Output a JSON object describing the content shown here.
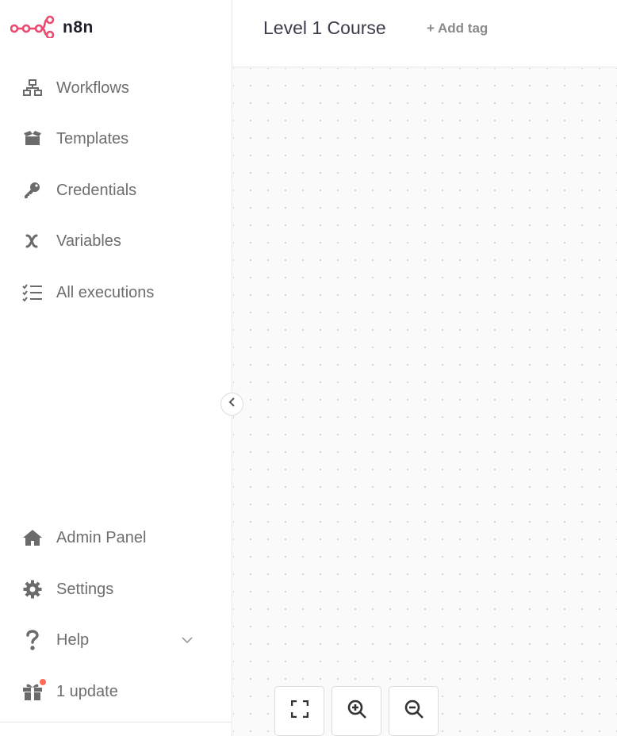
{
  "brand": {
    "name": "n8n",
    "logo_color": "#ea4b71"
  },
  "sidebar": {
    "items": [
      {
        "label": "Workflows",
        "icon": "workflows-icon"
      },
      {
        "label": "Templates",
        "icon": "templates-icon"
      },
      {
        "label": "Credentials",
        "icon": "key-icon"
      },
      {
        "label": "Variables",
        "icon": "variables-icon"
      },
      {
        "label": "All executions",
        "icon": "executions-icon"
      }
    ],
    "bottom_items": [
      {
        "label": "Admin Panel",
        "icon": "home-icon"
      },
      {
        "label": "Settings",
        "icon": "gear-icon"
      },
      {
        "label": "Help",
        "icon": "question-icon"
      },
      {
        "label": "1 update",
        "icon": "gift-icon"
      }
    ]
  },
  "header": {
    "workflow_title": "Level 1 Course",
    "add_tag_label": "+ Add tag"
  },
  "colors": {
    "accent": "#ea4b71",
    "badge": "#ff6d5a",
    "canvas_bg": "#fafafb"
  }
}
